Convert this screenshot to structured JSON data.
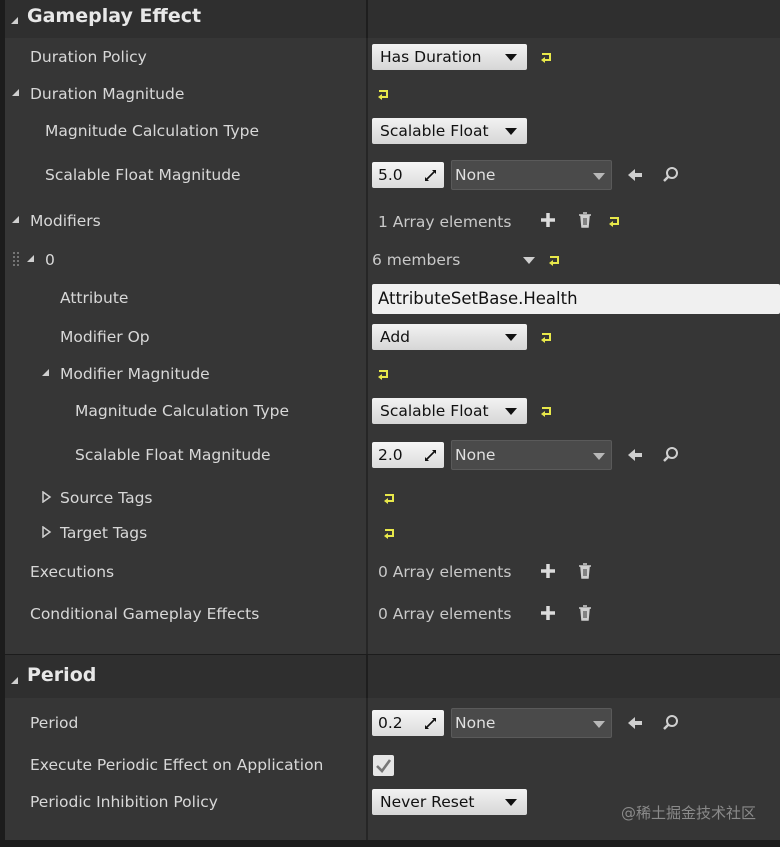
{
  "sections": {
    "gameplay_effect": "Gameplay Effect",
    "period": "Period"
  },
  "rows": {
    "duration_policy": {
      "label": "Duration Policy",
      "value": "Has Duration"
    },
    "duration_magnitude": {
      "label": "Duration Magnitude"
    },
    "dm_calc_type": {
      "label": "Magnitude Calculation Type",
      "value": "Scalable Float"
    },
    "dm_scalable": {
      "label": "Scalable Float Magnitude",
      "value": "5.0",
      "curve": "None"
    },
    "modifiers": {
      "label": "Modifiers",
      "value": "1 Array elements"
    },
    "mod0": {
      "label": "0",
      "value": "6 members"
    },
    "attribute": {
      "label": "Attribute",
      "value": "AttributeSetBase.Health"
    },
    "modifier_op": {
      "label": "Modifier Op",
      "value": "Add"
    },
    "modifier_magnitude": {
      "label": "Modifier Magnitude"
    },
    "mm_calc_type": {
      "label": "Magnitude Calculation Type",
      "value": "Scalable Float"
    },
    "mm_scalable": {
      "label": "Scalable Float Magnitude",
      "value": "2.0",
      "curve": "None"
    },
    "source_tags": {
      "label": "Source Tags"
    },
    "target_tags": {
      "label": "Target Tags"
    },
    "executions": {
      "label": "Executions",
      "value": "0 Array elements"
    },
    "conditional": {
      "label": "Conditional Gameplay Effects",
      "value": "0 Array elements"
    },
    "period": {
      "label": "Period",
      "value": "0.2",
      "curve": "None"
    },
    "exec_periodic": {
      "label": "Execute Periodic Effect on Application",
      "checked": true
    },
    "periodic_inhibition": {
      "label": "Periodic Inhibition Policy",
      "value": "Never Reset"
    }
  },
  "watermark": "@稀土掘金技术社区",
  "colors": {
    "reset_arrow": "#e8e84a",
    "panel_bg": "#363636",
    "header_bg": "#2f2f2f"
  }
}
